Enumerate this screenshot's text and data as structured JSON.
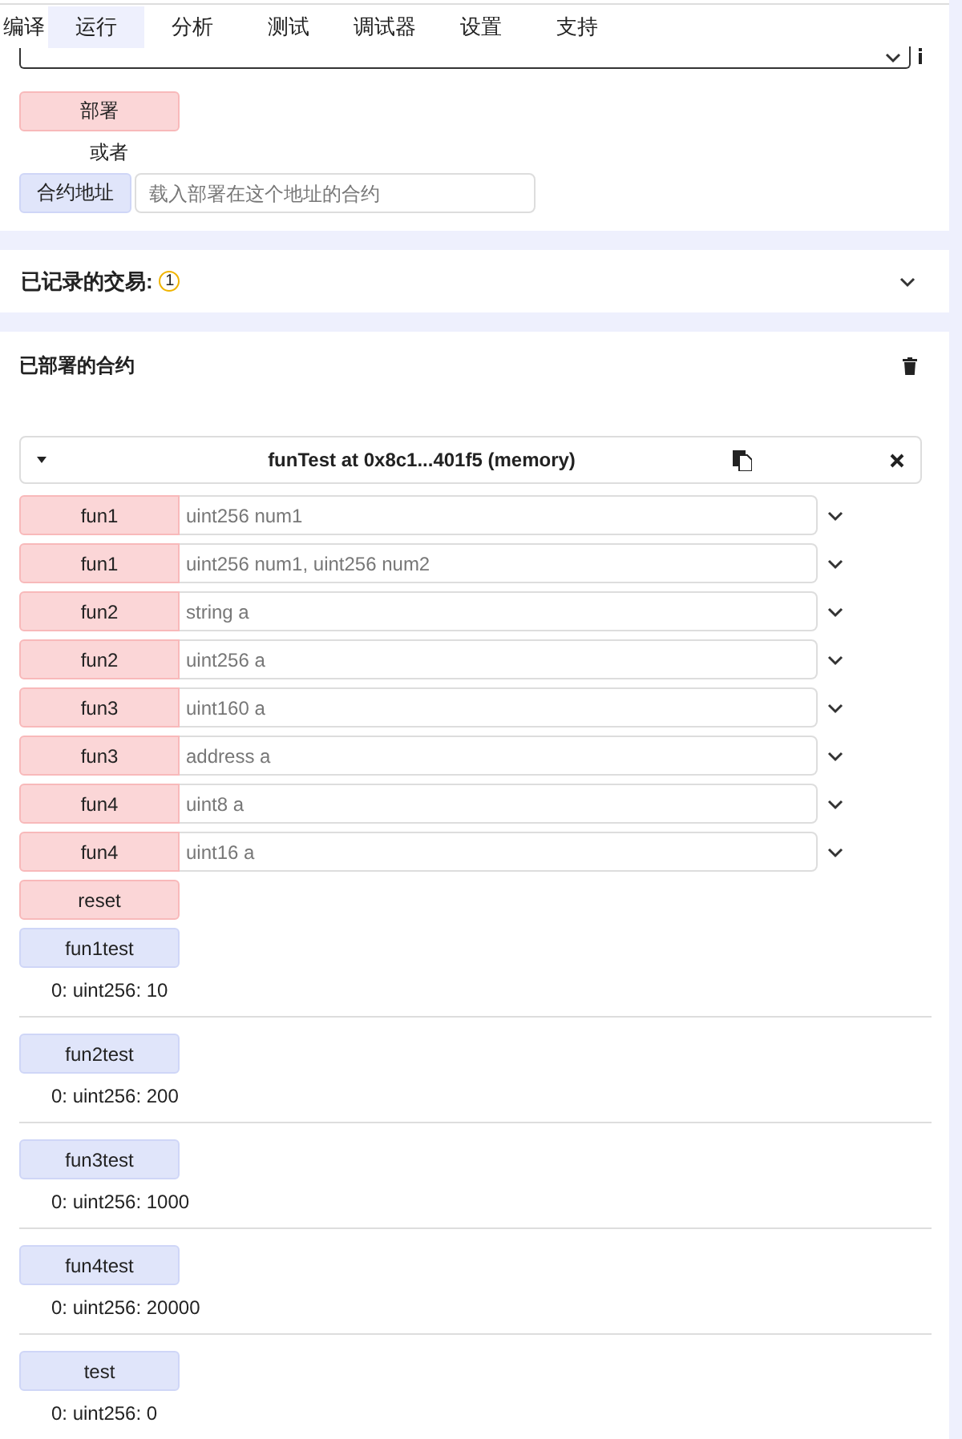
{
  "tabs": [
    {
      "label": "编译",
      "selected": false
    },
    {
      "label": "运行",
      "selected": true
    },
    {
      "label": "分析",
      "selected": false
    },
    {
      "label": "测试",
      "selected": false
    },
    {
      "label": "调试器",
      "selected": false
    },
    {
      "label": "设置",
      "selected": false
    },
    {
      "label": "支持",
      "selected": false
    }
  ],
  "deploy": {
    "button": "部署",
    "or": "或者",
    "at_address_button": "合约地址",
    "at_address_placeholder": "载入部署在这个地址的合约"
  },
  "transactions": {
    "title": "已记录的交易:",
    "count": "1"
  },
  "deployed": {
    "title": "已部署的合约",
    "instance": {
      "title": "funTest at 0x8c1...401f5 (memory)",
      "functions": [
        {
          "name": "fun1",
          "kind": "transact",
          "placeholder": "uint256 num1"
        },
        {
          "name": "fun1",
          "kind": "transact",
          "placeholder": "uint256 num1, uint256 num2"
        },
        {
          "name": "fun2",
          "kind": "transact",
          "placeholder": "string a"
        },
        {
          "name": "fun2",
          "kind": "transact",
          "placeholder": "uint256 a"
        },
        {
          "name": "fun3",
          "kind": "transact",
          "placeholder": "uint160 a"
        },
        {
          "name": "fun3",
          "kind": "transact",
          "placeholder": "address a"
        },
        {
          "name": "fun4",
          "kind": "transact",
          "placeholder": "uint8 a"
        },
        {
          "name": "fun4",
          "kind": "transact",
          "placeholder": "uint16 a"
        },
        {
          "name": "reset",
          "kind": "transact"
        },
        {
          "name": "fun1test",
          "kind": "call",
          "output": "0: uint256: 10"
        },
        {
          "name": "fun2test",
          "kind": "call",
          "output": "0: uint256: 200"
        },
        {
          "name": "fun3test",
          "kind": "call",
          "output": "0: uint256: 1000"
        },
        {
          "name": "fun4test",
          "kind": "call",
          "output": "0: uint256: 20000"
        },
        {
          "name": "test",
          "kind": "call",
          "output": "0: uint256: 0"
        }
      ]
    }
  }
}
